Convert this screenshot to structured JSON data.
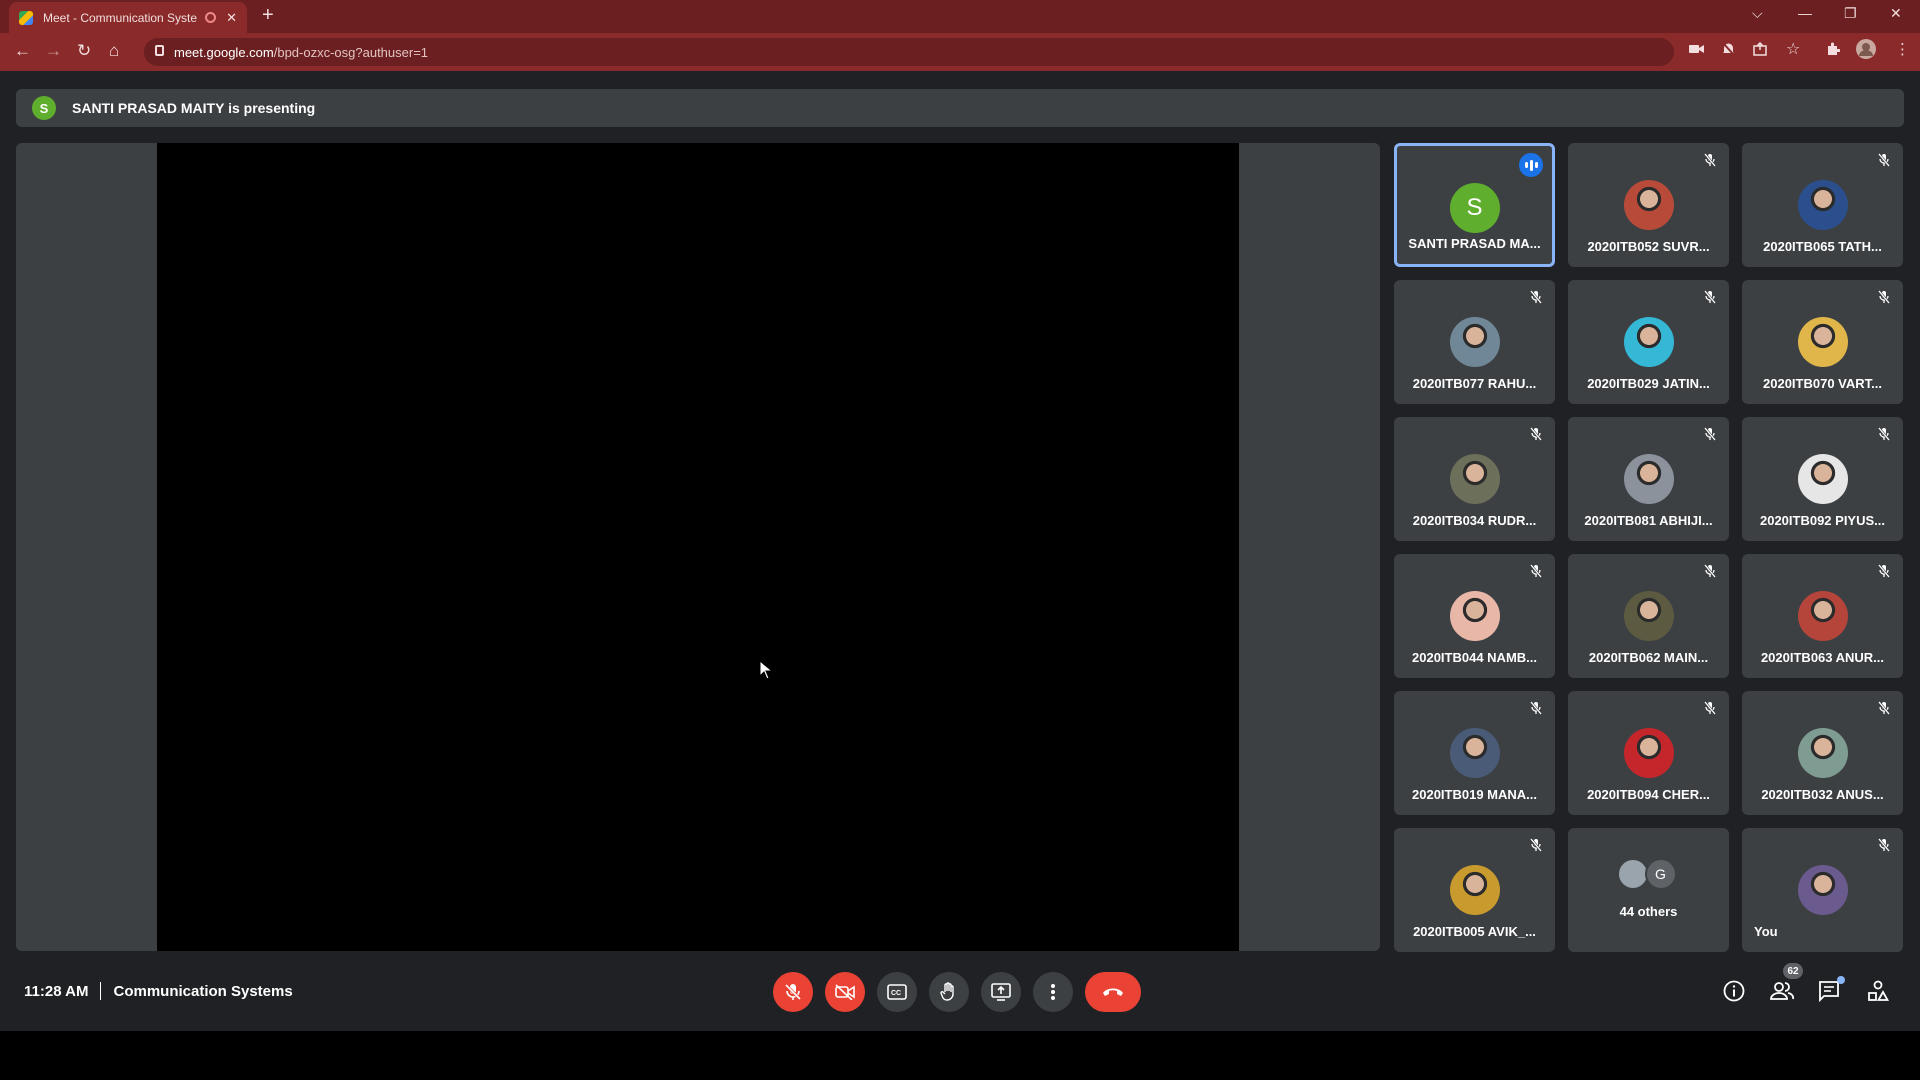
{
  "browser": {
    "tab_title": "Meet - Communication Syste",
    "url_host": "meet.google.com",
    "url_path": "/bpd-ozxc-osg?authuser=1"
  },
  "meet": {
    "presenting_initial": "S",
    "presenting_text": "SANTI PRASAD MAITY is presenting",
    "time": "11:28 AM",
    "meeting_title": "Communication Systems",
    "people_count": "62"
  },
  "participants": [
    {
      "name": "SANTI PRASAD MA...",
      "initial": "S",
      "color": "#5fae2e",
      "speaking": true
    },
    {
      "name": "2020ITB052 SUVR...",
      "color": "#b84a3a"
    },
    {
      "name": "2020ITB065 TATH...",
      "color": "#2a4f8c"
    },
    {
      "name": "2020ITB077 RAHU...",
      "color": "#6f8796"
    },
    {
      "name": "2020ITB029 JATIN...",
      "color": "#35b7d6"
    },
    {
      "name": "2020ITB070 VART...",
      "color": "#e0b64a"
    },
    {
      "name": "2020ITB034 RUDR...",
      "color": "#6c6f5a"
    },
    {
      "name": "2020ITB081 ABHIJI...",
      "color": "#8b929b"
    },
    {
      "name": "2020ITB092 PIYUS...",
      "color": "#e6e6e6"
    },
    {
      "name": "2020ITB044 NAMB...",
      "color": "#e8b7a8"
    },
    {
      "name": "2020ITB062 MAIN...",
      "color": "#5c5a40"
    },
    {
      "name": "2020ITB063 ANUR...",
      "color": "#b5443a"
    },
    {
      "name": "2020ITB019 MANA...",
      "color": "#4a5b78"
    },
    {
      "name": "2020ITB094 CHER...",
      "color": "#c4262b"
    },
    {
      "name": "2020ITB032 ANUS...",
      "color": "#7f9c92"
    },
    {
      "name": "2020ITB005 AVIK_...",
      "color": "#c99b2e"
    },
    {
      "name": "44 others",
      "others": true,
      "other_initial": "G"
    },
    {
      "name": "You",
      "color": "#6b5a8e",
      "self": true
    }
  ],
  "colors": {
    "chrome_frame": "#6b1f20",
    "meet_bg": "#202124",
    "tile_bg": "#3c4043",
    "red": "#ea4335",
    "accent": "#8ab4f8"
  },
  "icons": [
    "back-icon",
    "forward-icon",
    "reload-icon",
    "home-icon",
    "lock-icon",
    "camera-icon",
    "bell-off-icon",
    "share-icon",
    "star-icon",
    "extensions-icon",
    "profile-icon",
    "menu-icon",
    "mic-off-icon",
    "camera-off-icon",
    "captions-icon",
    "raise-hand-icon",
    "present-icon",
    "more-options-icon",
    "hang-up-icon",
    "info-icon",
    "people-icon",
    "chat-icon",
    "activities-icon"
  ]
}
